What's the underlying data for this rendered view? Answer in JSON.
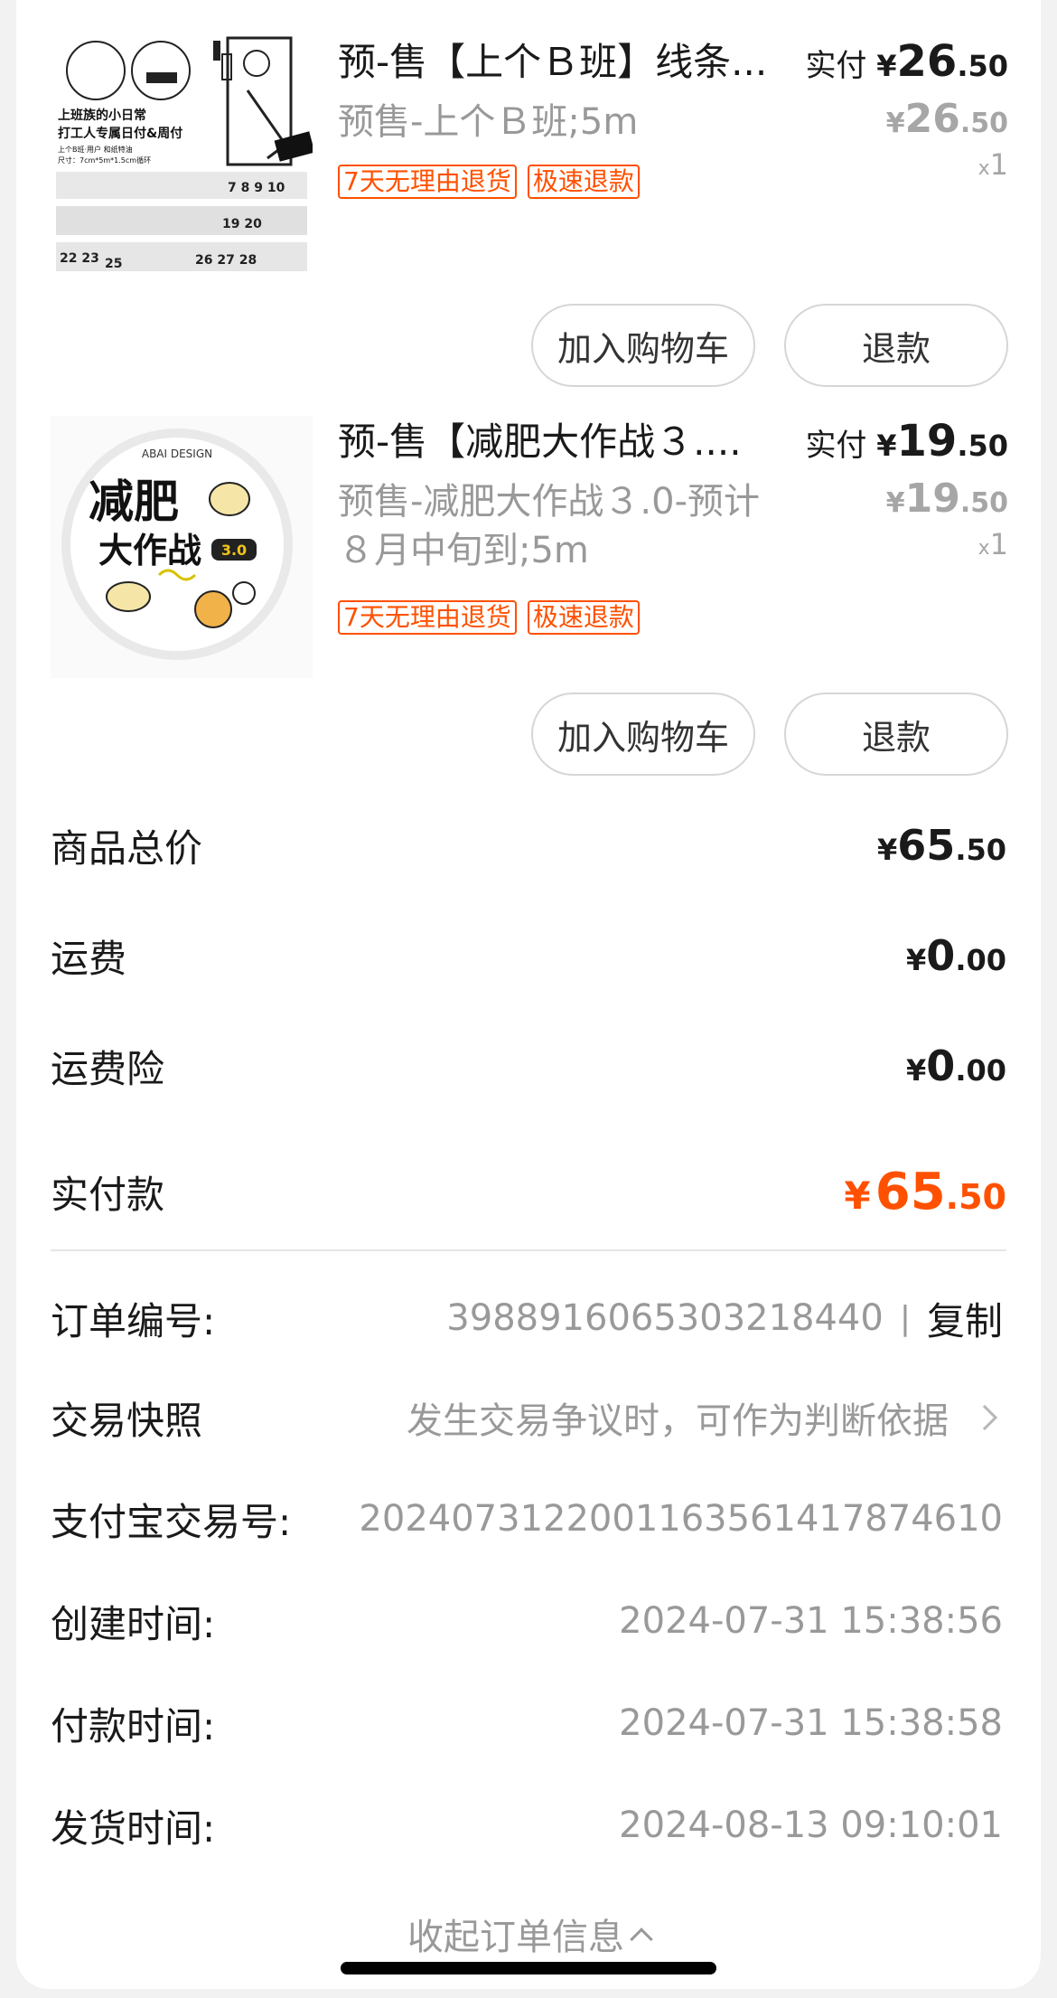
{
  "products": [
    {
      "title": "预-售【上个Ｂ班】线条...",
      "sku": "预售-上个Ｂ班;5m",
      "tags": [
        "7天无理由退货",
        "极速退款"
      ],
      "paid_label": "实付",
      "paid_yen": "¥",
      "paid_int": "26",
      "paid_dec": ".50",
      "orig_yen": "¥",
      "orig_int": "26",
      "orig_dec": ".50",
      "qty_x": "x",
      "qty": "1",
      "btn_cart": "加入购物车",
      "btn_refund": "退款",
      "thumb_text": {
        "line1": "上班族的小日常",
        "line2": "打工人专属日付&周付",
        "line3": "上个B班·用户 和纸特油",
        "line4": "尺寸：7cm*5m*1.5cm循环",
        "badge": "上班族"
      }
    },
    {
      "title": "预-售【减肥大作战３....",
      "sku": "预售-减肥大作战３.0-预计８月中旬到;5m",
      "tags": [
        "7天无理由退货",
        "极速退款"
      ],
      "paid_label": "实付",
      "paid_yen": "¥",
      "paid_int": "19",
      "paid_dec": ".50",
      "orig_yen": "¥",
      "orig_int": "19",
      "orig_dec": ".50",
      "qty_x": "x",
      "qty": "1",
      "btn_cart": "加入购物车",
      "btn_refund": "退款",
      "thumb_text": {
        "brand": "ABAI DESIGN",
        "line1": "减肥",
        "line2": "大作战",
        "version": "3.0"
      }
    }
  ],
  "summary": {
    "goods_total_label": "商品总价",
    "goods_total_yen": "¥",
    "goods_total_int": "65",
    "goods_total_dec": ".50",
    "shipping_label": "运费",
    "shipping_yen": "¥",
    "shipping_int": "0",
    "shipping_dec": ".00",
    "shipping_ins_label": "运费险",
    "shipping_ins_yen": "¥",
    "shipping_ins_int": "0",
    "shipping_ins_dec": ".00",
    "paid_label": "实付款",
    "paid_yen": "¥",
    "paid_int": "65",
    "paid_dec": ".50"
  },
  "order_info": {
    "order_no_label": "订单编号:",
    "order_no": "3988916065303218440",
    "separator": "|",
    "copy_label": "复制",
    "snapshot_label": "交易快照",
    "snapshot_text": "发生交易争议时，可作为判断依据",
    "alipay_label": "支付宝交易号:",
    "alipay_no": "2024073122001163561417874610",
    "created_label": "创建时间:",
    "created_time": "2024-07-31 15:38:56",
    "paid_time_label": "付款时间:",
    "paid_time": "2024-07-31 15:38:58",
    "shipped_label": "发货时间:",
    "shipped_time": "2024-08-13 09:10:01"
  },
  "collapse_label": "收起订单信息",
  "colors": {
    "accent": "#ff5000",
    "muted": "#999999",
    "text": "#1a1a1a"
  }
}
